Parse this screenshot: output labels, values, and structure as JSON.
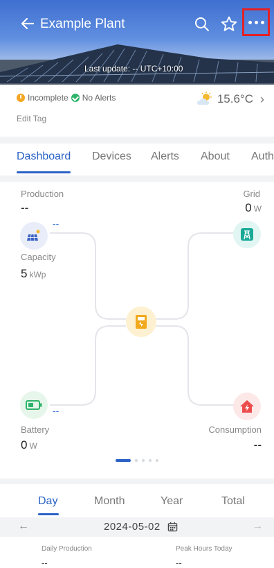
{
  "header": {
    "title": "Example Plant",
    "last_update": "Last update: -- UTC+10:00"
  },
  "info": {
    "status_incomplete": "Incomplete",
    "status_alerts": "No Alerts",
    "edit_tag": "Edit Tag",
    "temperature": "15.6°C",
    "weather_icon": "partly-cloudy-icon"
  },
  "tabs": [
    {
      "label": "Dashboard",
      "active": true
    },
    {
      "label": "Devices"
    },
    {
      "label": "Alerts"
    },
    {
      "label": "About"
    },
    {
      "label": "Auth"
    }
  ],
  "flow": {
    "production_label": "Production",
    "production_value": "--",
    "production_mark": "--",
    "capacity_label": "Capacity",
    "capacity_value": "5",
    "capacity_unit": "kWp",
    "grid_label": "Grid",
    "grid_value": "0",
    "grid_unit": "W",
    "battery_label": "Battery",
    "battery_value": "0",
    "battery_unit": "W",
    "battery_mark": "--",
    "consumption_label": "Consumption",
    "consumption_value": "--"
  },
  "period": {
    "tabs": [
      "Day",
      "Month",
      "Year",
      "Total"
    ],
    "active": "Day",
    "date": "2024-05-02",
    "daily_production_label": "Daily Production",
    "daily_production_value": "--",
    "peak_hours_label": "Peak Hours Today",
    "peak_hours_value": "--"
  },
  "colors": {
    "accent": "#2a62c6",
    "highlight_box": "#e32127"
  }
}
